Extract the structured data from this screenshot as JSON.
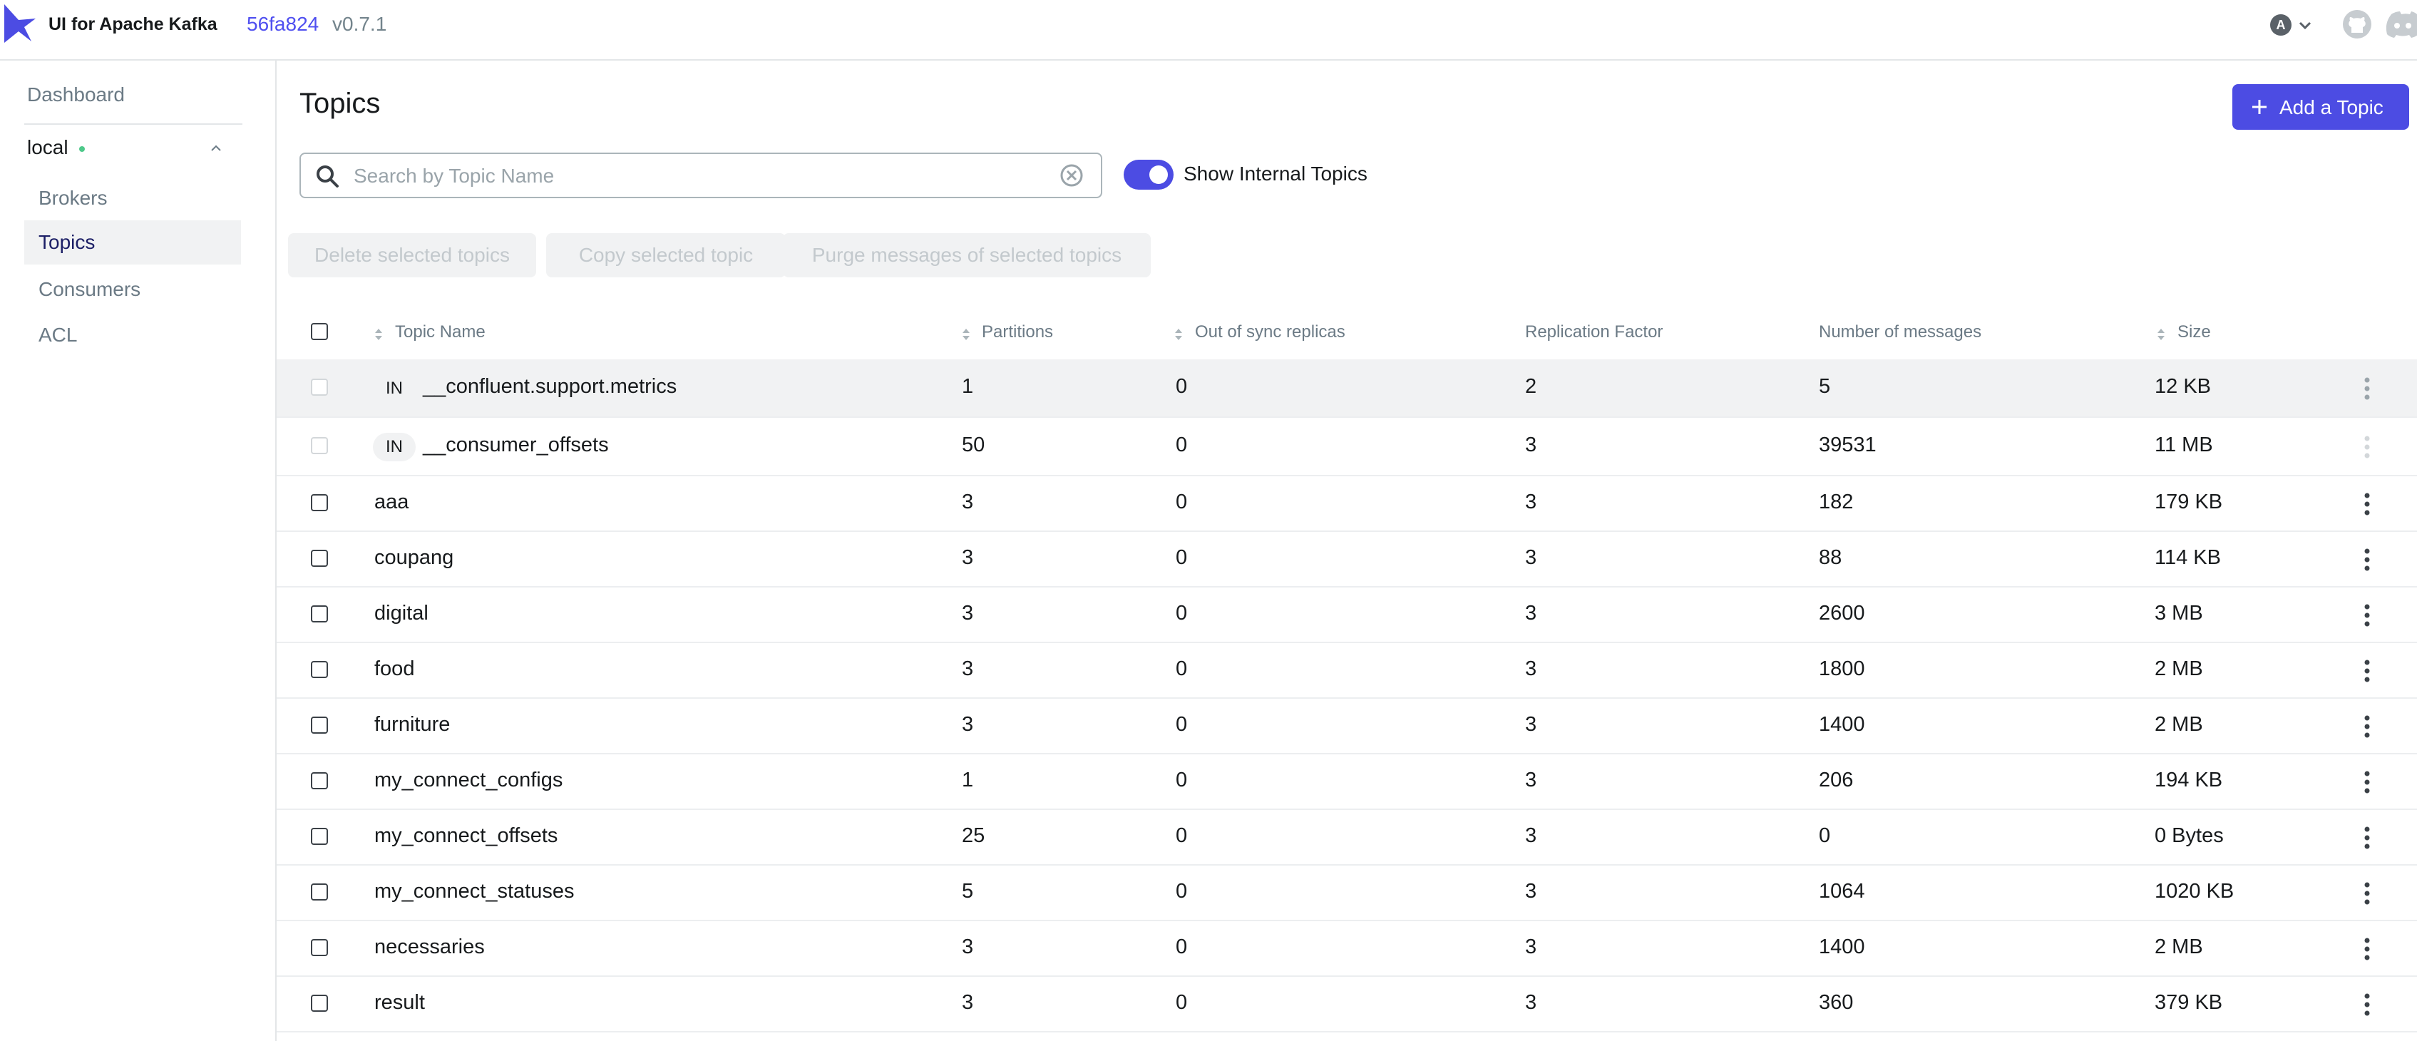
{
  "header": {
    "app_title": "UI for Apache Kafka",
    "version_hash": "56fa824",
    "version_num": "v0.7.1",
    "avatar_letter": "A"
  },
  "sidebar": {
    "dashboard": "Dashboard",
    "cluster": "local",
    "items": [
      {
        "label": "Brokers",
        "active": false
      },
      {
        "label": "Topics",
        "active": true
      },
      {
        "label": "Consumers",
        "active": false
      },
      {
        "label": "ACL",
        "active": false
      }
    ]
  },
  "main": {
    "title": "Topics",
    "add_button": "Add a Topic",
    "search_placeholder": "Search by Topic Name",
    "show_internal_label": "Show Internal Topics",
    "show_internal_on": true,
    "bulk_actions": [
      "Delete selected topics",
      "Copy selected topic",
      "Purge messages of selected topics"
    ]
  },
  "table": {
    "columns": [
      "Topic Name",
      "Partitions",
      "Out of sync replicas",
      "Replication Factor",
      "Number of messages",
      "Size"
    ],
    "rows": [
      {
        "internal": "IN",
        "name": "__confluent.support.metrics",
        "partitions": "1",
        "out_of_sync": "0",
        "replication": "2",
        "messages": "5",
        "size": "12 KB"
      },
      {
        "internal": "IN",
        "name": "__consumer_offsets",
        "partitions": "50",
        "out_of_sync": "0",
        "replication": "3",
        "messages": "39531",
        "size": "11 MB"
      },
      {
        "internal": "",
        "name": "aaa",
        "partitions": "3",
        "out_of_sync": "0",
        "replication": "3",
        "messages": "182",
        "size": "179 KB"
      },
      {
        "internal": "",
        "name": "coupang",
        "partitions": "3",
        "out_of_sync": "0",
        "replication": "3",
        "messages": "88",
        "size": "114 KB"
      },
      {
        "internal": "",
        "name": "digital",
        "partitions": "3",
        "out_of_sync": "0",
        "replication": "3",
        "messages": "2600",
        "size": "3 MB"
      },
      {
        "internal": "",
        "name": "food",
        "partitions": "3",
        "out_of_sync": "0",
        "replication": "3",
        "messages": "1800",
        "size": "2 MB"
      },
      {
        "internal": "",
        "name": "furniture",
        "partitions": "3",
        "out_of_sync": "0",
        "replication": "3",
        "messages": "1400",
        "size": "2 MB"
      },
      {
        "internal": "",
        "name": "my_connect_configs",
        "partitions": "1",
        "out_of_sync": "0",
        "replication": "3",
        "messages": "206",
        "size": "194 KB"
      },
      {
        "internal": "",
        "name": "my_connect_offsets",
        "partitions": "25",
        "out_of_sync": "0",
        "replication": "3",
        "messages": "0",
        "size": "0 Bytes"
      },
      {
        "internal": "",
        "name": "my_connect_statuses",
        "partitions": "5",
        "out_of_sync": "0",
        "replication": "3",
        "messages": "1064",
        "size": "1020 KB"
      },
      {
        "internal": "",
        "name": "necessaries",
        "partitions": "3",
        "out_of_sync": "0",
        "replication": "3",
        "messages": "1400",
        "size": "2 MB"
      },
      {
        "internal": "",
        "name": "result",
        "partitions": "3",
        "out_of_sync": "0",
        "replication": "3",
        "messages": "360",
        "size": "379 KB"
      }
    ]
  },
  "colors": {
    "accent": "#4c4ce3",
    "status_online": "#4ec98a",
    "active_nav_text": "#1c1f66"
  }
}
